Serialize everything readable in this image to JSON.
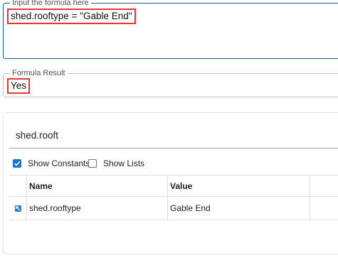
{
  "formula": {
    "legend": "Input the formula here",
    "value": "shed.rooftype = \"Gable End\""
  },
  "result": {
    "legend": "Formula Result",
    "value": "Yes"
  },
  "search": {
    "value": "shed.rooft"
  },
  "options": {
    "show_constants": {
      "label": "Show Constants",
      "checked": true
    },
    "show_lists": {
      "label": "Show Lists",
      "checked": false
    }
  },
  "table": {
    "columns": [
      "Name",
      "Value"
    ],
    "rows": [
      {
        "icon": "variable-icon",
        "name": "shed.rooftype",
        "value": "Gable End"
      }
    ]
  },
  "colors": {
    "accent": "#1976d2",
    "highlight": "#e53935",
    "focus_border": "#1e5e8c"
  }
}
